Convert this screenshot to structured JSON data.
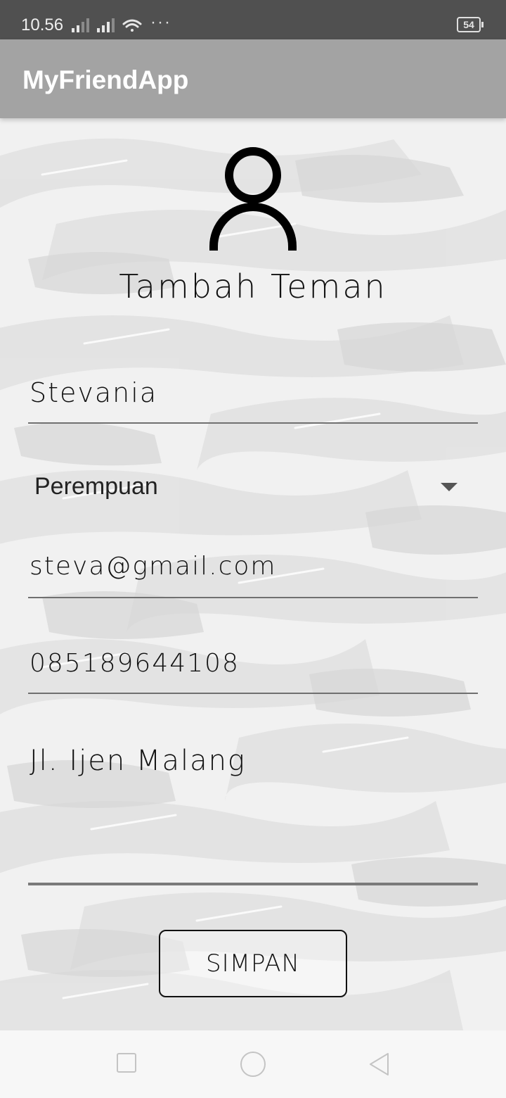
{
  "status_bar": {
    "time": "10.56",
    "more": "···",
    "battery": "54"
  },
  "app_bar": {
    "title": "MyFriendApp"
  },
  "form": {
    "title": "Tambah Teman",
    "name_value": "Stevania",
    "gender_selected": "Perempuan",
    "email_value": "steva@gmail.com",
    "phone_value": "085189644108",
    "address_value": "Jl. Ijen Malang",
    "save_label": "SIMPAN"
  },
  "icons": {
    "avatar": "person-outline-icon",
    "dropdown": "triangle-down-icon",
    "nav_recents": "square-icon",
    "nav_home": "circle-icon",
    "nav_back": "triangle-back-icon"
  },
  "colors": {
    "status_bar": "#505050",
    "app_bar": "#a3a3a3",
    "background": "#f2f2f2",
    "text": "#111111"
  }
}
